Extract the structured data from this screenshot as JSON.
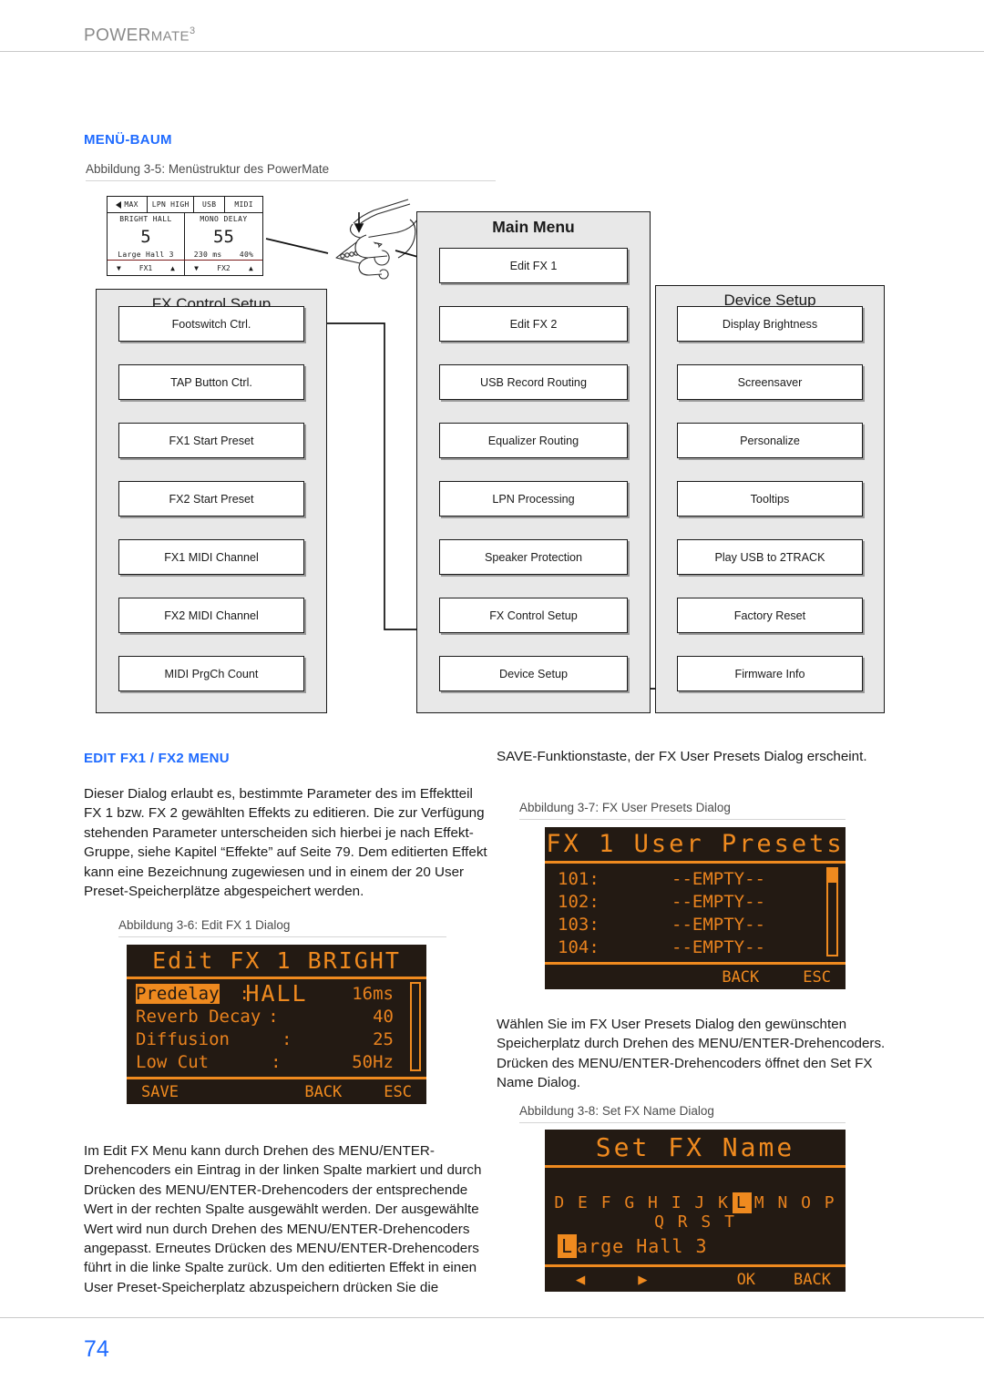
{
  "header": {
    "product": "POWER",
    "product_b": "MATE",
    "product_sup": "3"
  },
  "footer": {
    "page_number": "74"
  },
  "sections": {
    "menu_tree": {
      "heading_big": "M",
      "heading_rest": "ENÜ-B",
      "heading_rest2": "AUM",
      "heading_full": "MENÜ-BAUM"
    },
    "edit_fx": {
      "heading_full": "EDIT FX1 / FX2 MENU"
    }
  },
  "figures": {
    "fig35": "Abbildung 3-5: Menüstruktur des PowerMate",
    "fig36": "Abbildung 3-6: Edit FX 1 Dialog",
    "fig37": "Abbildung 3-7: FX User Presets Dialog",
    "fig38": "Abbildung 3-8: Set FX Name Dialog"
  },
  "mini_lcd": {
    "status": [
      "MAX",
      "LPN HIGH",
      "USB",
      "MIDI"
    ],
    "left": {
      "name": "BRIGHT HALL",
      "value": "5",
      "sub": [
        "Large Hall 3"
      ]
    },
    "right": {
      "name": "MONO DELAY",
      "value": "55",
      "sub": [
        "230 ms",
        "40%"
      ]
    },
    "footer_left": {
      "down": "▼",
      "label": "FX1",
      "up": "▲"
    },
    "footer_right": {
      "down": "▼",
      "label": "FX2",
      "up": "▲"
    }
  },
  "diagram": {
    "columns": [
      {
        "title": "FX Control Setup",
        "bold": false,
        "items": [
          "Footswitch Ctrl.",
          "TAP Button Ctrl.",
          "FX1 Start Preset",
          "FX2 Start Preset",
          "FX1 MIDI Channel",
          "FX2 MIDI Channel",
          "MIDI PrgCh Count"
        ]
      },
      {
        "title": "Main Menu",
        "bold": true,
        "items": [
          "Edit FX 1",
          "Edit FX 2",
          "USB Record Routing",
          "Equalizer Routing",
          "LPN Processing",
          "Speaker Protection",
          "FX Control Setup",
          "Device Setup"
        ]
      },
      {
        "title": "Device Setup",
        "bold": false,
        "items": [
          "Display Brightness",
          "Screensaver",
          "Personalize",
          "Tooltips",
          "Play USB to 2TRACK",
          "Factory Reset",
          "Firmware Info"
        ]
      }
    ]
  },
  "text": {
    "left_p1": "Dieser Dialog erlaubt es, bestimmte Parameter des im Effektteil FX 1 bzw. FX 2 gewählten Effekts zu editieren. Die zur Verfügung stehenden Parameter unterscheiden sich hierbei je nach Effekt-Gruppe, siehe Kapitel “Effekte” auf Seite 79. Dem editierten Effekt kann eine Bezeichnung zugewiesen und in einem der 20 User Preset-Speicherplätze abgespeichert werden.",
    "left_p2": "Im Edit FX Menu kann durch Drehen des MENU/ENTER-Drehencoders ein Eintrag in der linken Spalte markiert und durch Drücken des MENU/ENTER-Drehencoders der entsprechende Wert in der rechten Spalte ausgewählt werden. Der ausgewählte Wert wird nun durch Drehen des MENU/ENTER-Drehencoders angepasst. Erneutes Drücken des MENU/ENTER-Drehencoders führt in die linke Spalte zurück. Um den editierten Effekt in einen User Preset-Speicherplatz abzuspeichern drücken Sie die",
    "right_p1": "SAVE-Funktionstaste, der FX User Presets Dialog erscheint.",
    "right_p2": "Wählen Sie im FX User Presets Dialog den gewünschten Speicherplatz durch Drehen des MENU/ENTER-Drehencoders. Drücken des MENU/ENTER-Drehencoders öffnet den Set FX Name Dialog."
  },
  "lcd_edit_fx1": {
    "title": "Edit FX 1 BRIGHT HALL",
    "rows": [
      {
        "label": "Predelay",
        "sep": ":",
        "value": "16ms",
        "selected": true
      },
      {
        "label": "Reverb Decay",
        "sep": ":",
        "value": "40",
        "selected": false
      },
      {
        "label": "Diffusion",
        "sep": ":",
        "value": "25",
        "selected": false
      },
      {
        "label": "Low Cut",
        "sep": ":",
        "value": "50Hz",
        "selected": false
      }
    ],
    "softkeys": {
      "save": "SAVE",
      "back": "BACK",
      "esc": "ESC"
    }
  },
  "lcd_user_presets": {
    "title": "FX 1 User Presets",
    "rows": [
      {
        "slot": "101:",
        "value": "--EMPTY--"
      },
      {
        "slot": "102:",
        "value": "--EMPTY--"
      },
      {
        "slot": "103:",
        "value": "--EMPTY--"
      },
      {
        "slot": "104:",
        "value": "--EMPTY--"
      }
    ],
    "softkeys": {
      "back": "BACK",
      "esc": "ESC"
    }
  },
  "lcd_set_fx_name": {
    "title": "Set FX Name",
    "alphabet_before": "D E F G H I J K",
    "alphabet_selected": "L",
    "alphabet_after": "M N O P Q R S T",
    "name_first": "L",
    "name_rest": "arge Hall 3",
    "softkeys": {
      "left": "◀",
      "right": "▶",
      "ok": "OK",
      "back": "BACK"
    }
  },
  "colors": {
    "accent_blue": "#1f6bff",
    "lcd_orange": "#ef8a1f",
    "lcd_bg": "#231a13",
    "panel_gray": "#e8e8e8"
  }
}
